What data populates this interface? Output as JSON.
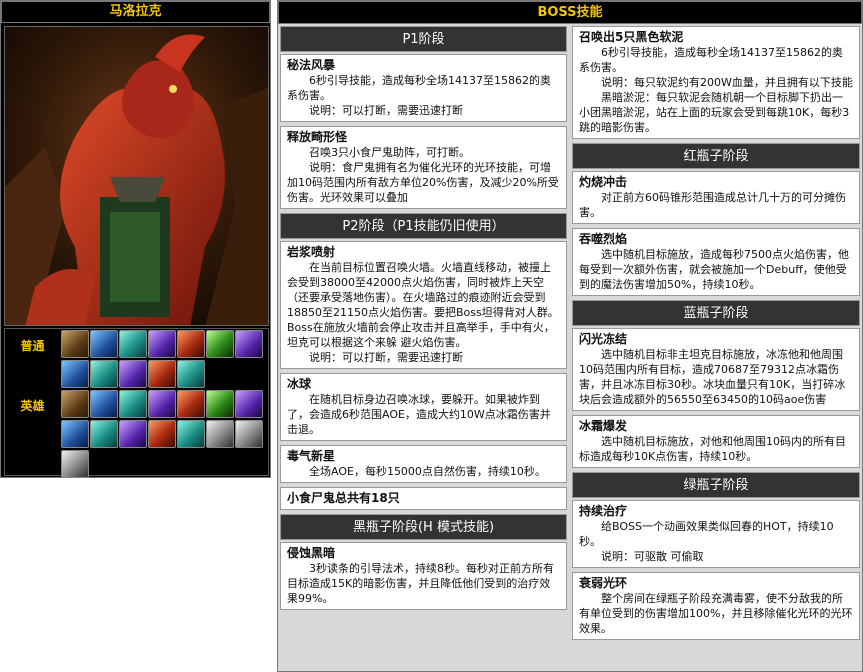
{
  "left": {
    "title": "马洛拉克",
    "normal_label": "普通",
    "heroic_label": "英雄",
    "normal_items": [
      "c-brown",
      "c-blue",
      "c-teal",
      "c-purple",
      "c-red",
      "c-green",
      "c-purple",
      "c-blue",
      "c-teal",
      "c-purple",
      "c-red",
      "c-teal"
    ],
    "heroic_items": [
      "c-brown",
      "c-blue",
      "c-teal",
      "c-purple",
      "c-red",
      "c-green",
      "c-purple",
      "c-blue",
      "c-teal",
      "c-purple",
      "c-red",
      "c-teal",
      "c-gray",
      "c-gray",
      "c-gray"
    ]
  },
  "right": {
    "title": "BOSS技能"
  },
  "col1": [
    {
      "type": "phase",
      "label": "P1阶段"
    },
    {
      "type": "box",
      "title": "秘法风暴",
      "lines": [
        "6秒引导技能，造成每秒全场14137至15862的奥系伤害。",
        "说明：可以打断，需要迅速打断"
      ]
    },
    {
      "type": "box",
      "title": "释放畸形怪",
      "lines": [
        "召唤3只小食尸鬼助阵，可打断。",
        "说明：食尸鬼拥有名为催化光环的光环技能，可增加10码范围内所有敌方单位20%伤害，及减少20%所受伤害。光环效果可以叠加"
      ]
    },
    {
      "type": "phase",
      "label": "P2阶段（P1技能仍旧使用）"
    },
    {
      "type": "box",
      "title": "岩浆喷射",
      "lines": [
        "在当前目标位置召唤火墙。火墙直线移动，被撞上会受到38000至42000点火焰伤害，同时被炸上天空（还要承受落地伤害）。在火墙路过的痕迹附近会受到18850至21150点火焰伤害。要把Boss坦得背对人群。Boss在施放火墙前会停止攻击并且高举手，手中有火，坦克可以根据这个来躲 避火焰伤害。",
        "说明：可以打断，需要迅速打断"
      ]
    },
    {
      "type": "box",
      "title": "冰球",
      "lines": [
        "在随机目标身边召唤冰球，要躲开。如果被炸到了，会造成6秒范围AOE，造成大约10W点冰霜伤害并击退。"
      ]
    },
    {
      "type": "box",
      "title": "毒气新星",
      "lines": [
        "全场AOE，每秒15000点自然伤害，持续10秒。"
      ]
    },
    {
      "type": "box",
      "title": "小食尸鬼总共有18只",
      "lines": []
    },
    {
      "type": "phase",
      "label": "黑瓶子阶段(H 模式技能)"
    },
    {
      "type": "box",
      "title": "侵蚀黑暗",
      "lines": [
        "3秒读条的引导法术，持续8秒。每秒对正前方所有目标造成15K的暗影伤害，并且降低他们受到的治疗效果99%。"
      ]
    }
  ],
  "col2": [
    {
      "type": "box",
      "title": "召唤出5只黑色软泥",
      "lines": [
        "6秒引导技能，造成每秒全场14137至15862的奥系伤害。",
        "说明：每只软泥约有200W血量，并且拥有以下技能",
        "黑暗淤泥：每只软泥会随机朝一个目标脚下扔出一小团黑暗淤泥，站在上面的玩家会受到每跳10K，每秒3跳的暗影伤害。"
      ]
    },
    {
      "type": "phase",
      "label": "红瓶子阶段"
    },
    {
      "type": "box",
      "title": "灼烧冲击",
      "lines": [
        "对正前方60码锥形范围造成总计几十万的可分摊伤害。"
      ]
    },
    {
      "type": "box",
      "title": "吞噬烈焰",
      "lines": [
        "选中随机目标施放，造成每秒7500点火焰伤害，他每受到一次额外伤害，就会被施加一个Debuff，使他受到的魔法伤害增加50%，持续10秒。"
      ]
    },
    {
      "type": "phase",
      "label": "蓝瓶子阶段"
    },
    {
      "type": "box",
      "title": "闪光冻结",
      "lines": [
        "选中随机目标非主坦克目标施放，冰冻他和他周围10码范围内所有目标，造成70687至79312点冰霜伤害，并且冰冻目标30秒。冰块血量只有10K，当打碎冰块后会造成额外的56550至63450的10码aoe伤害"
      ]
    },
    {
      "type": "box",
      "title": "冰霜爆发",
      "lines": [
        "选中随机目标施放，对他和他周围10码内的所有目标造成每秒10K点伤害，持续10秒。"
      ]
    },
    {
      "type": "phase",
      "label": "绿瓶子阶段"
    },
    {
      "type": "box",
      "title": "持续治疗",
      "lines": [
        "给BOSS一个动画效果类似回春的HOT，持续10秒。",
        "说明：可驱散 可偷取"
      ]
    },
    {
      "type": "box",
      "title": "衰弱光环",
      "lines": [
        "整个房间在绿瓶子阶段充满毒雾，使不分敌我的所有单位受到的伤害增加100%，并且移除催化光环的光环效果。"
      ]
    }
  ]
}
